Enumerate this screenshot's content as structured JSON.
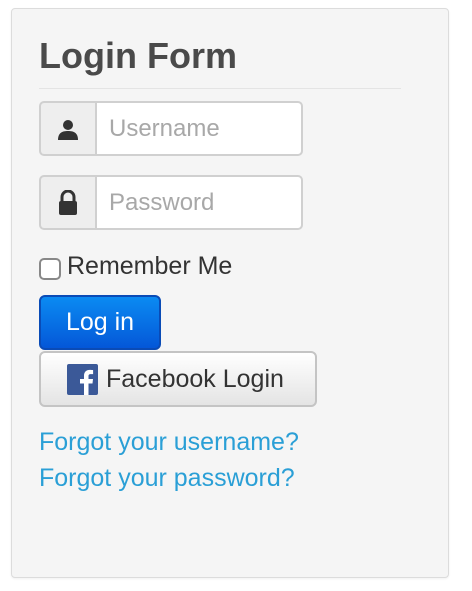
{
  "form": {
    "title": "Login Form",
    "username": {
      "placeholder": "Username",
      "value": "",
      "icon": "user-icon"
    },
    "password": {
      "placeholder": "Password",
      "value": "",
      "icon": "lock-icon"
    },
    "remember_label": "Remember Me",
    "remember_checked": false,
    "login_label": "Log in",
    "facebook_label": "Facebook Login",
    "facebook_icon": "facebook-icon",
    "forgot_username": "Forgot your username?",
    "forgot_password": "Forgot your password?"
  },
  "colors": {
    "primary_button": "#0670e6",
    "link": "#2a9fd6",
    "facebook": "#3b5998",
    "panel_background": "#f5f5f5"
  }
}
